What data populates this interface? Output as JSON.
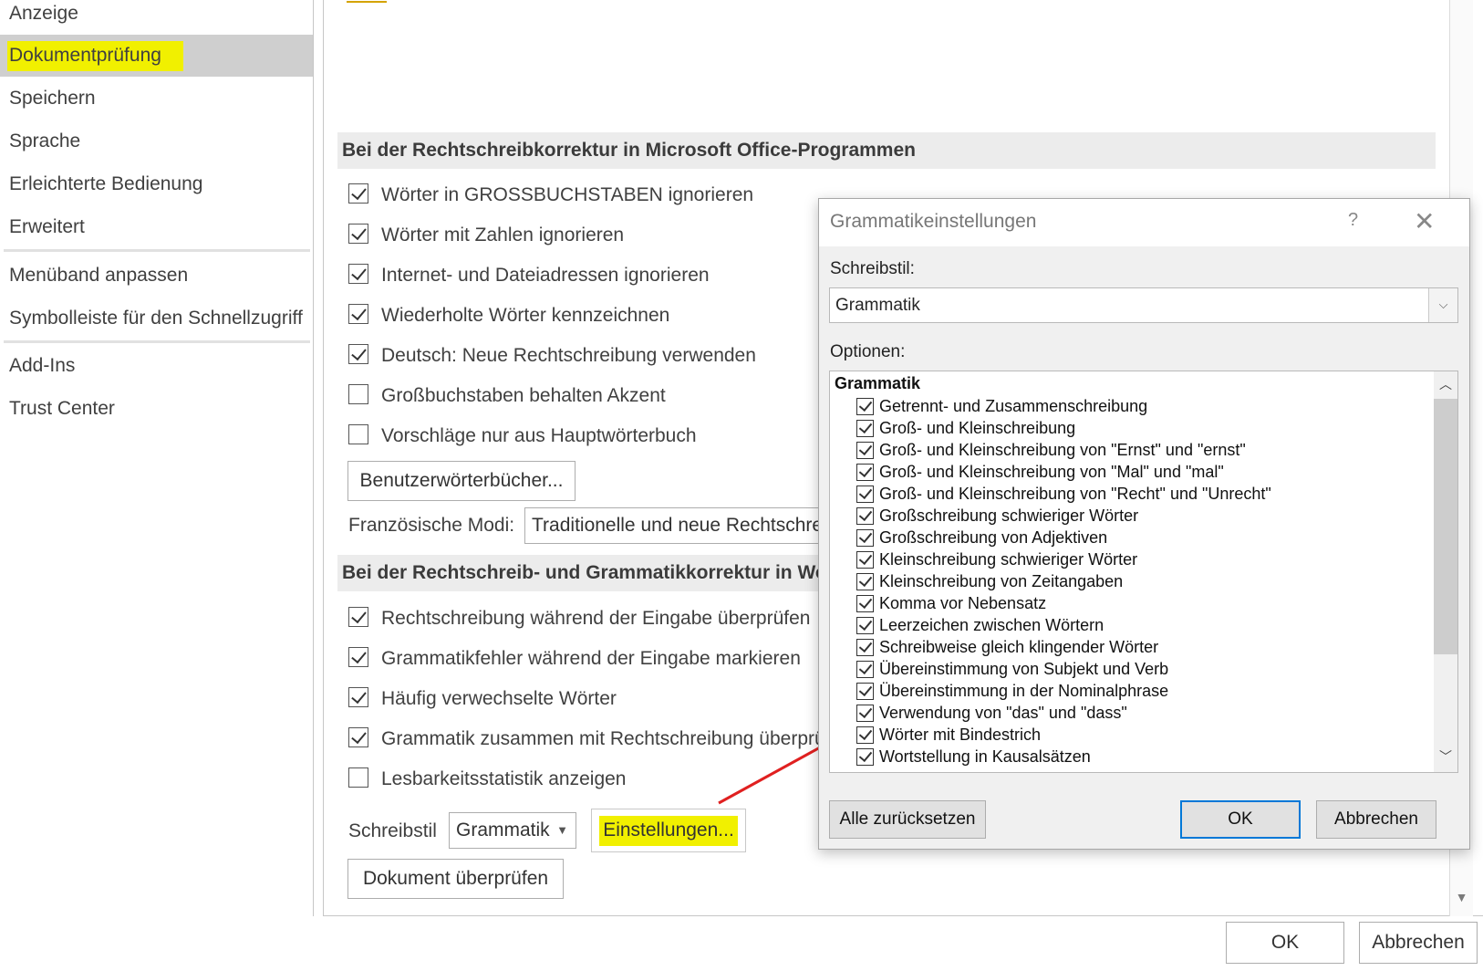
{
  "nav": {
    "items": [
      {
        "label": "Anzeige"
      },
      {
        "label": "Dokumentprüfung"
      },
      {
        "label": "Speichern"
      },
      {
        "label": "Sprache"
      },
      {
        "label": "Erleichterte Bedienung"
      },
      {
        "label": "Erweitert"
      },
      {
        "label": "Menüband anpassen"
      },
      {
        "label": "Symbolleiste für den Schnellzugriff"
      },
      {
        "label": "Add-Ins"
      },
      {
        "label": "Trust Center"
      }
    ],
    "selected": "Dokumentprüfung",
    "highlight_color": "#f1f000"
  },
  "office_section": {
    "header": "Bei der Rechtschreibkorrektur in Microsoft Office-Programmen",
    "options": [
      {
        "label": "Wörter in GROSSBUCHSTABEN ignorieren",
        "checked": true
      },
      {
        "label": "Wörter mit Zahlen ignorieren",
        "checked": true
      },
      {
        "label": "Internet- und Dateiadressen ignorieren",
        "checked": true
      },
      {
        "label": "Wiederholte Wörter kennzeichnen",
        "checked": true
      },
      {
        "label": "Deutsch: Neue Rechtschreibung verwenden",
        "checked": true
      },
      {
        "label": "Großbuchstaben behalten Akzent",
        "checked": false
      },
      {
        "label": "Vorschläge nur aus Hauptwörterbuch",
        "checked": false
      }
    ],
    "custom_dict_button": "Benutzerwörterbücher...",
    "french_modes_label": "Französische Modi:",
    "french_modes_value": "Traditionelle und neue Rechtschre"
  },
  "word_section": {
    "header": "Bei der Rechtschreib- und Grammatikkorrektur in Wo",
    "options": [
      {
        "label": "Rechtschreibung während der Eingabe überprüfen",
        "checked": true
      },
      {
        "label": "Grammatikfehler während der Eingabe markieren",
        "checked": true
      },
      {
        "label": "Häufig verwechselte Wörter",
        "checked": true
      },
      {
        "label": "Grammatik zusammen mit Rechtschreibung überprü",
        "checked": true
      },
      {
        "label": "Lesbarkeitsstatistik anzeigen",
        "checked": false
      }
    ],
    "writing_style_label": "Schreibstil",
    "writing_style_value": "Grammatik",
    "settings_button": "Einstellungen...",
    "check_document_button": "Dokument überprüfen"
  },
  "footer": {
    "ok": "OK",
    "cancel": "Abbrechen"
  },
  "dialog": {
    "title": "Grammatikeinstellungen",
    "help": "?",
    "close": "✕",
    "style_label": "Schreibstil:",
    "style_value": "Grammatik",
    "options_label": "Optionen:",
    "group": "Grammatik",
    "items": [
      {
        "label": "Getrennt- und Zusammenschreibung",
        "checked": true
      },
      {
        "label": "Groß- und Kleinschreibung",
        "checked": true
      },
      {
        "label": "Groß- und Kleinschreibung von \"Ernst\" und \"ernst\"",
        "checked": true
      },
      {
        "label": "Groß- und Kleinschreibung von \"Mal\" und \"mal\"",
        "checked": true
      },
      {
        "label": "Groß- und Kleinschreibung von \"Recht\" und \"Unrecht\"",
        "checked": true
      },
      {
        "label": "Großschreibung schwieriger Wörter",
        "checked": true
      },
      {
        "label": "Großschreibung von Adjektiven",
        "checked": true
      },
      {
        "label": "Kleinschreibung schwieriger Wörter",
        "checked": true
      },
      {
        "label": "Kleinschreibung von Zeitangaben",
        "checked": true
      },
      {
        "label": "Komma vor Nebensatz",
        "checked": true
      },
      {
        "label": "Leerzeichen zwischen Wörtern",
        "checked": true
      },
      {
        "label": "Schreibweise gleich klingender Wörter",
        "checked": true
      },
      {
        "label": "Übereinstimmung von Subjekt und Verb",
        "checked": true
      },
      {
        "label": "Übereinstimmung in der Nominalphrase",
        "checked": true
      },
      {
        "label": "Verwendung von \"das\" und \"dass\"",
        "checked": true
      },
      {
        "label": "Wörter mit Bindestrich",
        "checked": true
      },
      {
        "label": "Wortstellung in Kausalsätzen",
        "checked": true
      }
    ],
    "reset_button": "Alle zurücksetzen",
    "ok_button": "OK",
    "cancel_button": "Abbrechen",
    "accent_color": "#0078d7"
  },
  "annotation": {
    "arrow_color": "#e02020"
  }
}
